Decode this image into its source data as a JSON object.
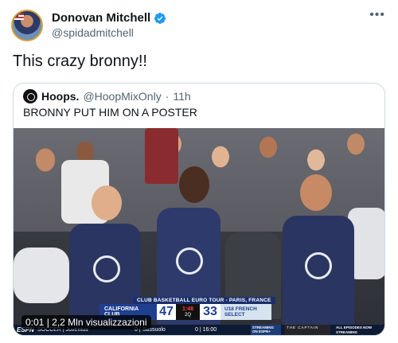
{
  "author": {
    "name": "Donovan Mitchell",
    "handle": "@spidadmitchell",
    "verified": true
  },
  "more_icon": "more-horizontal-icon",
  "tweet_text": "This crazy bronny!!",
  "quote": {
    "name": "Hoops.",
    "handle": "@HoopMixOnly",
    "separator": "·",
    "time": "11h",
    "text": "BRONNY PUT HIM ON A POSTER"
  },
  "video": {
    "badge": "0:01 | 2,2 Mln visualizzazioni",
    "scoreboard": {
      "title": "CLUB BASKETBALL EURO TOUR - PARIS, FRANCE",
      "team_a": "CALIFORNIA CLUB",
      "score_a": "47",
      "bonus": "1:48",
      "period": "2Q",
      "score_b": "33",
      "team_b": "U18 FRENCH SELECT"
    },
    "ticker": {
      "network": "ESPN",
      "left_text": "SOCCER | Juventus",
      "score": "0 |",
      "opponent": "Sassuolo",
      "clock": "0 | 16:00",
      "streaming": "STREAMING ON ESPN+",
      "promo": "THE CAPTAIN",
      "now": "ALL EPISODES NOW STREAMING"
    }
  },
  "colors": {
    "verified": "#1d9bf0",
    "text": "#0f1419",
    "muted": "#536471",
    "border": "#cfd9de"
  }
}
